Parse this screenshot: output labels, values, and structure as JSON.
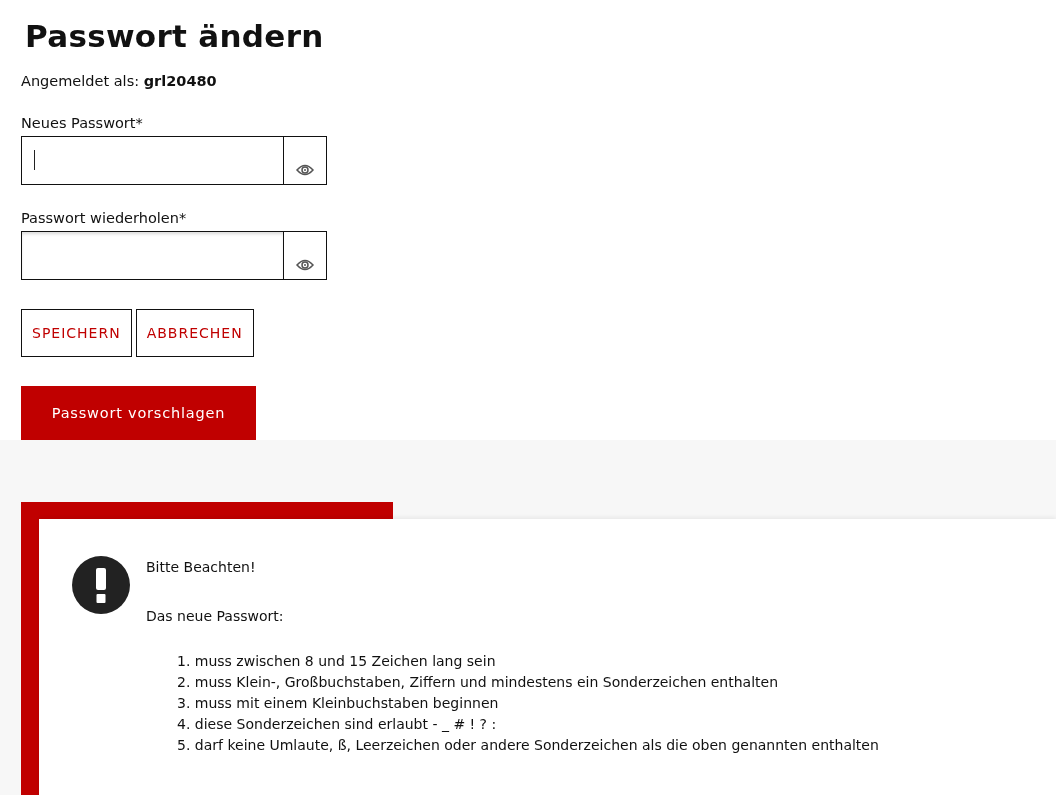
{
  "title": "Passwort ändern",
  "logged_in": {
    "label": "Angemeldet als:",
    "user": "grl20480"
  },
  "fields": [
    {
      "label": "Neues Passwort*",
      "focused": true
    },
    {
      "label": "Passwort wiederholen*",
      "focused": false
    }
  ],
  "buttons": [
    "SPEICHERN",
    "ABBRECHEN"
  ],
  "suggest_button": "Passwort vorschlagen",
  "notice": {
    "heading": "Bitte Beachten!",
    "intro": "Das neue Passwort:",
    "rules": [
      "1. muss zwischen 8 und 15 Zeichen lang sein",
      "2. muss Klein-, Großbuchstaben, Ziffern und mindestens ein Sonderzeichen enthalten",
      "3. muss mit einem Kleinbuchstaben beginnen",
      "4. diese Sonderzeichen sind erlaubt - _ # ! ? :",
      "5. darf keine Umlaute, ß, Leerzeichen oder andere Sonderzeichen als die oben genannten enthalten"
    ]
  }
}
